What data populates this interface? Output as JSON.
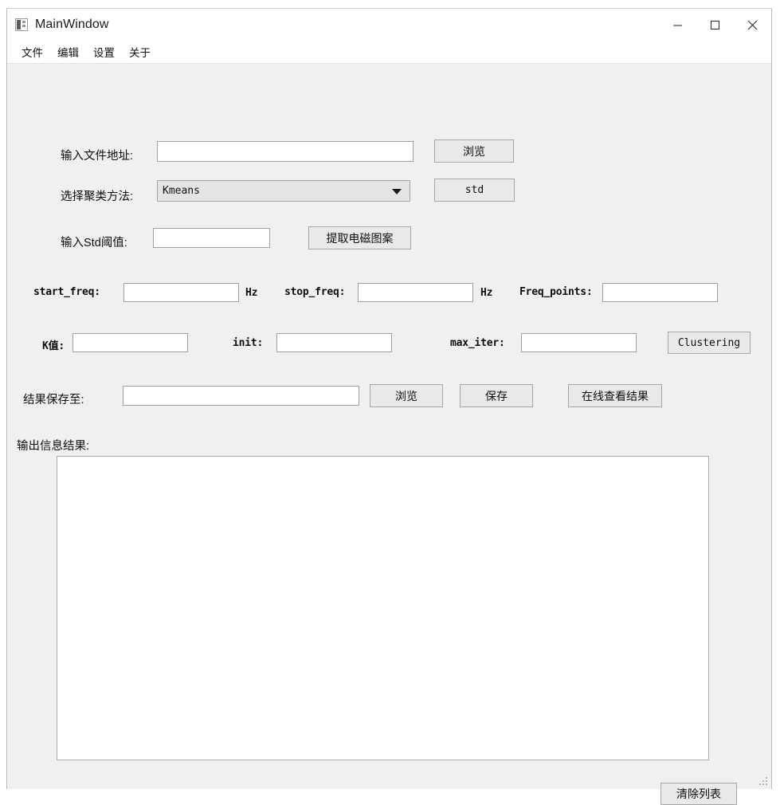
{
  "window": {
    "title": "MainWindow",
    "icon": "app-icon",
    "controls": {
      "minimize": "minimize-icon",
      "maximize": "maximize-icon",
      "close": "close-icon"
    }
  },
  "menubar": {
    "items": [
      {
        "label": "文件"
      },
      {
        "label": "编辑"
      },
      {
        "label": "设置"
      },
      {
        "label": "关于"
      }
    ]
  },
  "form": {
    "file_path": {
      "label": "输入文件地址:",
      "value": "",
      "placeholder": "",
      "browse_button": "浏览"
    },
    "cluster_method": {
      "label": "选择聚类方法:",
      "selected": "Kmeans",
      "options": [
        "Kmeans"
      ],
      "std_button": "std"
    },
    "std_threshold": {
      "label": "输入Std阈值:",
      "value": "",
      "placeholder": "",
      "extract_button": "提取电磁图案"
    },
    "start_freq": {
      "label": "start_freq:",
      "value": "",
      "unit": "Hz"
    },
    "stop_freq": {
      "label": "stop_freq:",
      "value": "",
      "unit": "Hz"
    },
    "freq_points": {
      "label": "Freq_points:",
      "value": ""
    },
    "k_value": {
      "label": "K值:",
      "value": ""
    },
    "init": {
      "label": "init:",
      "value": ""
    },
    "max_iter": {
      "label": "max_iter:",
      "value": ""
    },
    "clustering_button": "Clustering",
    "save_path": {
      "label": "结果保存至:",
      "value": "",
      "placeholder": "",
      "browse_button": "浏览",
      "save_button": "保存",
      "online_view_button": "在线查看结果"
    }
  },
  "output": {
    "label": "输出信息结果:",
    "content": "",
    "clear_button": "清除列表"
  },
  "colors": {
    "window_bg": "#f0f0f0",
    "titlebar_bg": "#ffffff",
    "button_bg": "#e9e9e9",
    "field_bg": "#ffffff",
    "border": "#a0a0a0",
    "text": "#0d0d0d"
  }
}
